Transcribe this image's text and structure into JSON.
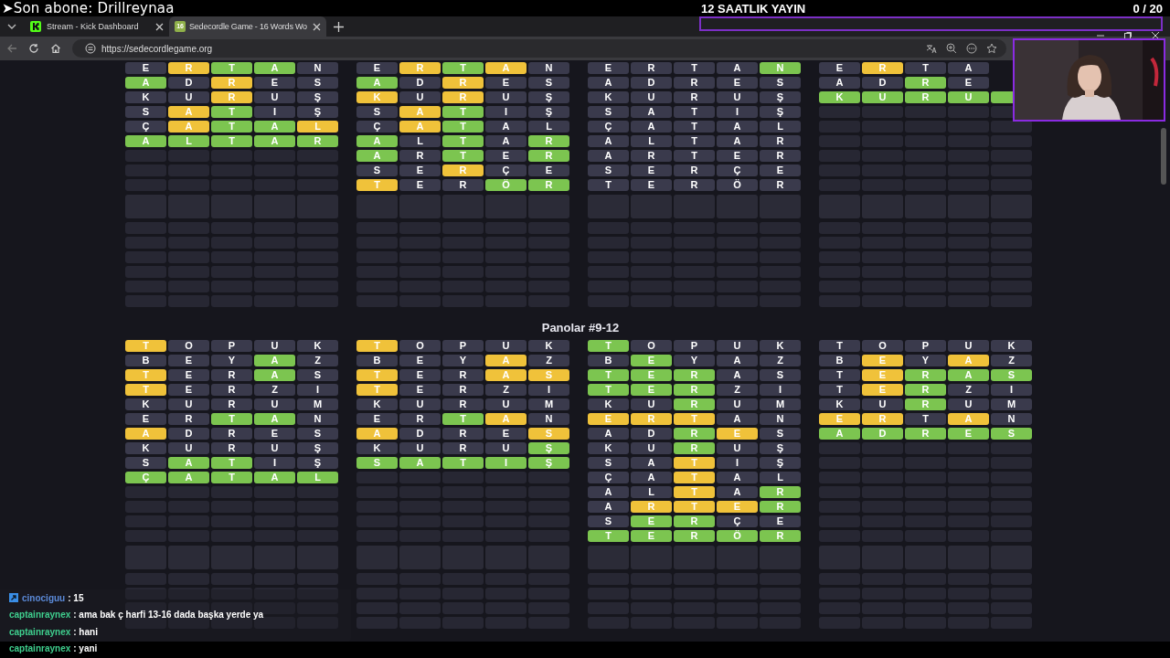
{
  "stream_overlay": {
    "latest_subscriber": "➤Son abone: Drillreynaa",
    "title": "12 SAATLIK YAYIN",
    "goal_count": "0 / 20"
  },
  "browser": {
    "tabs": [
      {
        "label": "Stream - Kick Dashboard",
        "selected": false
      },
      {
        "label": "Sedecordle Game - 16 Words Wo",
        "selected": true,
        "icon_text": "16"
      }
    ],
    "address": "https://sedecordlegame.org"
  },
  "boards_top": [
    {
      "rows": [
        [
          {
            "letter": "E",
            "kind": "absent"
          },
          {
            "letter": "R",
            "kind": "present"
          },
          {
            "letter": "T",
            "kind": "correct"
          },
          {
            "letter": "A",
            "kind": "correct"
          },
          {
            "letter": "N",
            "kind": "absent"
          }
        ],
        [
          {
            "letter": "A",
            "kind": "correct"
          },
          {
            "letter": "D",
            "kind": "absent"
          },
          {
            "letter": "R",
            "kind": "present"
          },
          {
            "letter": "E",
            "kind": "absent"
          },
          {
            "letter": "S",
            "kind": "absent"
          }
        ],
        [
          {
            "letter": "K",
            "kind": "absent"
          },
          {
            "letter": "U",
            "kind": "absent"
          },
          {
            "letter": "R",
            "kind": "present"
          },
          {
            "letter": "U",
            "kind": "absent"
          },
          {
            "letter": "Ş",
            "kind": "absent"
          }
        ],
        [
          {
            "letter": "S",
            "kind": "absent"
          },
          {
            "letter": "A",
            "kind": "present"
          },
          {
            "letter": "T",
            "kind": "correct"
          },
          {
            "letter": "I",
            "kind": "absent"
          },
          {
            "letter": "Ş",
            "kind": "absent"
          }
        ],
        [
          {
            "letter": "Ç",
            "kind": "absent"
          },
          {
            "letter": "A",
            "kind": "present"
          },
          {
            "letter": "T",
            "kind": "correct"
          },
          {
            "letter": "A",
            "kind": "correct"
          },
          {
            "letter": "L",
            "kind": "present"
          }
        ],
        [
          {
            "letter": "A",
            "kind": "correct"
          },
          {
            "letter": "L",
            "kind": "correct"
          },
          {
            "letter": "T",
            "kind": "correct"
          },
          {
            "letter": "A",
            "kind": "correct"
          },
          {
            "letter": "R",
            "kind": "correct"
          }
        ]
      ]
    },
    {
      "rows": [
        [
          {
            "letter": "E",
            "kind": "absent"
          },
          {
            "letter": "R",
            "kind": "present"
          },
          {
            "letter": "T",
            "kind": "correct"
          },
          {
            "letter": "A",
            "kind": "present"
          },
          {
            "letter": "N",
            "kind": "absent"
          }
        ],
        [
          {
            "letter": "A",
            "kind": "correct"
          },
          {
            "letter": "D",
            "kind": "absent"
          },
          {
            "letter": "R",
            "kind": "present"
          },
          {
            "letter": "E",
            "kind": "absent"
          },
          {
            "letter": "S",
            "kind": "absent"
          }
        ],
        [
          {
            "letter": "K",
            "kind": "present"
          },
          {
            "letter": "U",
            "kind": "absent"
          },
          {
            "letter": "R",
            "kind": "present"
          },
          {
            "letter": "U",
            "kind": "absent"
          },
          {
            "letter": "Ş",
            "kind": "absent"
          }
        ],
        [
          {
            "letter": "S",
            "kind": "absent"
          },
          {
            "letter": "A",
            "kind": "present"
          },
          {
            "letter": "T",
            "kind": "correct"
          },
          {
            "letter": "I",
            "kind": "absent"
          },
          {
            "letter": "Ş",
            "kind": "absent"
          }
        ],
        [
          {
            "letter": "Ç",
            "kind": "absent"
          },
          {
            "letter": "A",
            "kind": "present"
          },
          {
            "letter": "T",
            "kind": "correct"
          },
          {
            "letter": "A",
            "kind": "absent"
          },
          {
            "letter": "L",
            "kind": "absent"
          }
        ],
        [
          {
            "letter": "A",
            "kind": "correct"
          },
          {
            "letter": "L",
            "kind": "absent"
          },
          {
            "letter": "T",
            "kind": "correct"
          },
          {
            "letter": "A",
            "kind": "absent"
          },
          {
            "letter": "R",
            "kind": "correct"
          }
        ],
        [
          {
            "letter": "A",
            "kind": "correct"
          },
          {
            "letter": "R",
            "kind": "absent"
          },
          {
            "letter": "T",
            "kind": "correct"
          },
          {
            "letter": "E",
            "kind": "absent"
          },
          {
            "letter": "R",
            "kind": "correct"
          }
        ],
        [
          {
            "letter": "S",
            "kind": "absent"
          },
          {
            "letter": "E",
            "kind": "absent"
          },
          {
            "letter": "R",
            "kind": "present"
          },
          {
            "letter": "Ç",
            "kind": "absent"
          },
          {
            "letter": "E",
            "kind": "absent"
          }
        ],
        [
          {
            "letter": "T",
            "kind": "present"
          },
          {
            "letter": "E",
            "kind": "absent"
          },
          {
            "letter": "R",
            "kind": "absent"
          },
          {
            "letter": "Ö",
            "kind": "correct"
          },
          {
            "letter": "R",
            "kind": "correct"
          }
        ]
      ]
    },
    {
      "rows": [
        [
          {
            "letter": "E",
            "kind": "absent"
          },
          {
            "letter": "R",
            "kind": "absent"
          },
          {
            "letter": "T",
            "kind": "absent"
          },
          {
            "letter": "A",
            "kind": "absent"
          },
          {
            "letter": "N",
            "kind": "correct"
          }
        ],
        [
          {
            "letter": "A",
            "kind": "absent"
          },
          {
            "letter": "D",
            "kind": "absent"
          },
          {
            "letter": "R",
            "kind": "absent"
          },
          {
            "letter": "E",
            "kind": "absent"
          },
          {
            "letter": "S",
            "kind": "absent"
          }
        ],
        [
          {
            "letter": "K",
            "kind": "absent"
          },
          {
            "letter": "U",
            "kind": "absent"
          },
          {
            "letter": "R",
            "kind": "absent"
          },
          {
            "letter": "U",
            "kind": "absent"
          },
          {
            "letter": "Ş",
            "kind": "absent"
          }
        ],
        [
          {
            "letter": "S",
            "kind": "absent"
          },
          {
            "letter": "A",
            "kind": "absent"
          },
          {
            "letter": "T",
            "kind": "absent"
          },
          {
            "letter": "I",
            "kind": "absent"
          },
          {
            "letter": "Ş",
            "kind": "absent"
          }
        ],
        [
          {
            "letter": "Ç",
            "kind": "absent"
          },
          {
            "letter": "A",
            "kind": "absent"
          },
          {
            "letter": "T",
            "kind": "absent"
          },
          {
            "letter": "A",
            "kind": "absent"
          },
          {
            "letter": "L",
            "kind": "absent"
          }
        ],
        [
          {
            "letter": "A",
            "kind": "absent"
          },
          {
            "letter": "L",
            "kind": "absent"
          },
          {
            "letter": "T",
            "kind": "absent"
          },
          {
            "letter": "A",
            "kind": "absent"
          },
          {
            "letter": "R",
            "kind": "absent"
          }
        ],
        [
          {
            "letter": "A",
            "kind": "absent"
          },
          {
            "letter": "R",
            "kind": "absent"
          },
          {
            "letter": "T",
            "kind": "absent"
          },
          {
            "letter": "E",
            "kind": "absent"
          },
          {
            "letter": "R",
            "kind": "absent"
          }
        ],
        [
          {
            "letter": "S",
            "kind": "absent"
          },
          {
            "letter": "E",
            "kind": "absent"
          },
          {
            "letter": "R",
            "kind": "absent"
          },
          {
            "letter": "Ç",
            "kind": "absent"
          },
          {
            "letter": "E",
            "kind": "absent"
          }
        ],
        [
          {
            "letter": "T",
            "kind": "absent"
          },
          {
            "letter": "E",
            "kind": "absent"
          },
          {
            "letter": "R",
            "kind": "absent"
          },
          {
            "letter": "Ö",
            "kind": "absent"
          },
          {
            "letter": "R",
            "kind": "absent"
          }
        ]
      ]
    },
    {
      "rows": [
        [
          {
            "letter": "E",
            "kind": "absent"
          },
          {
            "letter": "R",
            "kind": "present"
          },
          {
            "letter": "T",
            "kind": "absent"
          },
          {
            "letter": "A",
            "kind": "absent"
          }
        ],
        [
          {
            "letter": "A",
            "kind": "absent"
          },
          {
            "letter": "D",
            "kind": "absent"
          },
          {
            "letter": "R",
            "kind": "correct"
          },
          {
            "letter": "E",
            "kind": "absent"
          }
        ],
        [
          {
            "letter": "K",
            "kind": "correct"
          },
          {
            "letter": "U",
            "kind": "correct"
          },
          {
            "letter": "R",
            "kind": "correct"
          },
          {
            "letter": "U",
            "kind": "correct"
          },
          {
            "kind": "correct"
          }
        ]
      ]
    }
  ],
  "section_heading": "Panolar #9-12",
  "boards_bottom": [
    {
      "rows": [
        [
          {
            "letter": "T",
            "kind": "present"
          },
          {
            "letter": "O",
            "kind": "absent"
          },
          {
            "letter": "P",
            "kind": "absent"
          },
          {
            "letter": "U",
            "kind": "absent"
          },
          {
            "letter": "K",
            "kind": "absent"
          }
        ],
        [
          {
            "letter": "B",
            "kind": "absent"
          },
          {
            "letter": "E",
            "kind": "absent"
          },
          {
            "letter": "Y",
            "kind": "absent"
          },
          {
            "letter": "A",
            "kind": "correct"
          },
          {
            "letter": "Z",
            "kind": "absent"
          }
        ],
        [
          {
            "letter": "T",
            "kind": "present"
          },
          {
            "letter": "E",
            "kind": "absent"
          },
          {
            "letter": "R",
            "kind": "absent"
          },
          {
            "letter": "A",
            "kind": "correct"
          },
          {
            "letter": "S",
            "kind": "absent"
          }
        ],
        [
          {
            "letter": "T",
            "kind": "present"
          },
          {
            "letter": "E",
            "kind": "absent"
          },
          {
            "letter": "R",
            "kind": "absent"
          },
          {
            "letter": "Z",
            "kind": "absent"
          },
          {
            "letter": "I",
            "kind": "absent"
          }
        ],
        [
          {
            "letter": "K",
            "kind": "absent"
          },
          {
            "letter": "U",
            "kind": "absent"
          },
          {
            "letter": "R",
            "kind": "absent"
          },
          {
            "letter": "U",
            "kind": "absent"
          },
          {
            "letter": "M",
            "kind": "absent"
          }
        ],
        [
          {
            "letter": "E",
            "kind": "absent"
          },
          {
            "letter": "R",
            "kind": "absent"
          },
          {
            "letter": "T",
            "kind": "correct"
          },
          {
            "letter": "A",
            "kind": "correct"
          },
          {
            "letter": "N",
            "kind": "absent"
          }
        ],
        [
          {
            "letter": "A",
            "kind": "present"
          },
          {
            "letter": "D",
            "kind": "absent"
          },
          {
            "letter": "R",
            "kind": "absent"
          },
          {
            "letter": "E",
            "kind": "absent"
          },
          {
            "letter": "S",
            "kind": "absent"
          }
        ],
        [
          {
            "letter": "K",
            "kind": "absent"
          },
          {
            "letter": "U",
            "kind": "absent"
          },
          {
            "letter": "R",
            "kind": "absent"
          },
          {
            "letter": "U",
            "kind": "absent"
          },
          {
            "letter": "Ş",
            "kind": "absent"
          }
        ],
        [
          {
            "letter": "S",
            "kind": "absent"
          },
          {
            "letter": "A",
            "kind": "correct"
          },
          {
            "letter": "T",
            "kind": "correct"
          },
          {
            "letter": "I",
            "kind": "absent"
          },
          {
            "letter": "Ş",
            "kind": "absent"
          }
        ],
        [
          {
            "letter": "Ç",
            "kind": "correct"
          },
          {
            "letter": "A",
            "kind": "correct"
          },
          {
            "letter": "T",
            "kind": "correct"
          },
          {
            "letter": "A",
            "kind": "correct"
          },
          {
            "letter": "L",
            "kind": "correct"
          }
        ]
      ]
    },
    {
      "rows": [
        [
          {
            "letter": "T",
            "kind": "present"
          },
          {
            "letter": "O",
            "kind": "absent"
          },
          {
            "letter": "P",
            "kind": "absent"
          },
          {
            "letter": "U",
            "kind": "absent"
          },
          {
            "letter": "K",
            "kind": "absent"
          }
        ],
        [
          {
            "letter": "B",
            "kind": "absent"
          },
          {
            "letter": "E",
            "kind": "absent"
          },
          {
            "letter": "Y",
            "kind": "absent"
          },
          {
            "letter": "A",
            "kind": "present"
          },
          {
            "letter": "Z",
            "kind": "absent"
          }
        ],
        [
          {
            "letter": "T",
            "kind": "present"
          },
          {
            "letter": "E",
            "kind": "absent"
          },
          {
            "letter": "R",
            "kind": "absent"
          },
          {
            "letter": "A",
            "kind": "present"
          },
          {
            "letter": "S",
            "kind": "present"
          }
        ],
        [
          {
            "letter": "T",
            "kind": "present"
          },
          {
            "letter": "E",
            "kind": "absent"
          },
          {
            "letter": "R",
            "kind": "absent"
          },
          {
            "letter": "Z",
            "kind": "absent"
          },
          {
            "letter": "I",
            "kind": "absent"
          }
        ],
        [
          {
            "letter": "K",
            "kind": "absent"
          },
          {
            "letter": "U",
            "kind": "absent"
          },
          {
            "letter": "R",
            "kind": "absent"
          },
          {
            "letter": "U",
            "kind": "absent"
          },
          {
            "letter": "M",
            "kind": "absent"
          }
        ],
        [
          {
            "letter": "E",
            "kind": "absent"
          },
          {
            "letter": "R",
            "kind": "absent"
          },
          {
            "letter": "T",
            "kind": "correct"
          },
          {
            "letter": "A",
            "kind": "present"
          },
          {
            "letter": "N",
            "kind": "absent"
          }
        ],
        [
          {
            "letter": "A",
            "kind": "present"
          },
          {
            "letter": "D",
            "kind": "absent"
          },
          {
            "letter": "R",
            "kind": "absent"
          },
          {
            "letter": "E",
            "kind": "absent"
          },
          {
            "letter": "S",
            "kind": "present"
          }
        ],
        [
          {
            "letter": "K",
            "kind": "absent"
          },
          {
            "letter": "U",
            "kind": "absent"
          },
          {
            "letter": "R",
            "kind": "absent"
          },
          {
            "letter": "U",
            "kind": "absent"
          },
          {
            "letter": "Ş",
            "kind": "correct"
          }
        ],
        [
          {
            "letter": "S",
            "kind": "correct"
          },
          {
            "letter": "A",
            "kind": "correct"
          },
          {
            "letter": "T",
            "kind": "correct"
          },
          {
            "letter": "I",
            "kind": "correct"
          },
          {
            "letter": "Ş",
            "kind": "correct"
          }
        ]
      ]
    },
    {
      "rows": [
        [
          {
            "letter": "T",
            "kind": "correct"
          },
          {
            "letter": "O",
            "kind": "absent"
          },
          {
            "letter": "P",
            "kind": "absent"
          },
          {
            "letter": "U",
            "kind": "absent"
          },
          {
            "letter": "K",
            "kind": "absent"
          }
        ],
        [
          {
            "letter": "B",
            "kind": "absent"
          },
          {
            "letter": "E",
            "kind": "correct"
          },
          {
            "letter": "Y",
            "kind": "absent"
          },
          {
            "letter": "A",
            "kind": "absent"
          },
          {
            "letter": "Z",
            "kind": "absent"
          }
        ],
        [
          {
            "letter": "T",
            "kind": "correct"
          },
          {
            "letter": "E",
            "kind": "correct"
          },
          {
            "letter": "R",
            "kind": "correct"
          },
          {
            "letter": "A",
            "kind": "absent"
          },
          {
            "letter": "S",
            "kind": "absent"
          }
        ],
        [
          {
            "letter": "T",
            "kind": "correct"
          },
          {
            "letter": "E",
            "kind": "correct"
          },
          {
            "letter": "R",
            "kind": "correct"
          },
          {
            "letter": "Z",
            "kind": "absent"
          },
          {
            "letter": "I",
            "kind": "absent"
          }
        ],
        [
          {
            "letter": "K",
            "kind": "absent"
          },
          {
            "letter": "U",
            "kind": "absent"
          },
          {
            "letter": "R",
            "kind": "correct"
          },
          {
            "letter": "U",
            "kind": "absent"
          },
          {
            "letter": "M",
            "kind": "absent"
          }
        ],
        [
          {
            "letter": "E",
            "kind": "present"
          },
          {
            "letter": "R",
            "kind": "present"
          },
          {
            "letter": "T",
            "kind": "present"
          },
          {
            "letter": "A",
            "kind": "absent"
          },
          {
            "letter": "N",
            "kind": "absent"
          }
        ],
        [
          {
            "letter": "A",
            "kind": "absent"
          },
          {
            "letter": "D",
            "kind": "absent"
          },
          {
            "letter": "R",
            "kind": "correct"
          },
          {
            "letter": "E",
            "kind": "present"
          },
          {
            "letter": "S",
            "kind": "absent"
          }
        ],
        [
          {
            "letter": "K",
            "kind": "absent"
          },
          {
            "letter": "U",
            "kind": "absent"
          },
          {
            "letter": "R",
            "kind": "correct"
          },
          {
            "letter": "U",
            "kind": "absent"
          },
          {
            "letter": "Ş",
            "kind": "absent"
          }
        ],
        [
          {
            "letter": "S",
            "kind": "absent"
          },
          {
            "letter": "A",
            "kind": "absent"
          },
          {
            "letter": "T",
            "kind": "present"
          },
          {
            "letter": "I",
            "kind": "absent"
          },
          {
            "letter": "Ş",
            "kind": "absent"
          }
        ],
        [
          {
            "letter": "Ç",
            "kind": "absent"
          },
          {
            "letter": "A",
            "kind": "absent"
          },
          {
            "letter": "T",
            "kind": "present"
          },
          {
            "letter": "A",
            "kind": "absent"
          },
          {
            "letter": "L",
            "kind": "absent"
          }
        ],
        [
          {
            "letter": "A",
            "kind": "absent"
          },
          {
            "letter": "L",
            "kind": "absent"
          },
          {
            "letter": "T",
            "kind": "present"
          },
          {
            "letter": "A",
            "kind": "absent"
          },
          {
            "letter": "R",
            "kind": "correct"
          }
        ],
        [
          {
            "letter": "A",
            "kind": "absent"
          },
          {
            "letter": "R",
            "kind": "present"
          },
          {
            "letter": "T",
            "kind": "present"
          },
          {
            "letter": "E",
            "kind": "present"
          },
          {
            "letter": "R",
            "kind": "correct"
          }
        ],
        [
          {
            "letter": "S",
            "kind": "absent"
          },
          {
            "letter": "E",
            "kind": "correct"
          },
          {
            "letter": "R",
            "kind": "correct"
          },
          {
            "letter": "Ç",
            "kind": "absent"
          },
          {
            "letter": "E",
            "kind": "absent"
          }
        ],
        [
          {
            "letter": "T",
            "kind": "correct"
          },
          {
            "letter": "E",
            "kind": "correct"
          },
          {
            "letter": "R",
            "kind": "correct"
          },
          {
            "letter": "Ö",
            "kind": "correct"
          },
          {
            "letter": "R",
            "kind": "correct"
          }
        ]
      ]
    },
    {
      "rows": [
        [
          {
            "letter": "T",
            "kind": "absent"
          },
          {
            "letter": "O",
            "kind": "absent"
          },
          {
            "letter": "P",
            "kind": "absent"
          },
          {
            "letter": "U",
            "kind": "absent"
          },
          {
            "letter": "K",
            "kind": "absent"
          }
        ],
        [
          {
            "letter": "B",
            "kind": "absent"
          },
          {
            "letter": "E",
            "kind": "present"
          },
          {
            "letter": "Y",
            "kind": "absent"
          },
          {
            "letter": "A",
            "kind": "present"
          },
          {
            "letter": "Z",
            "kind": "absent"
          }
        ],
        [
          {
            "letter": "T",
            "kind": "absent"
          },
          {
            "letter": "E",
            "kind": "present"
          },
          {
            "letter": "R",
            "kind": "correct"
          },
          {
            "letter": "A",
            "kind": "correct"
          },
          {
            "letter": "S",
            "kind": "correct"
          }
        ],
        [
          {
            "letter": "T",
            "kind": "absent"
          },
          {
            "letter": "E",
            "kind": "present"
          },
          {
            "letter": "R",
            "kind": "correct"
          },
          {
            "letter": "Z",
            "kind": "absent"
          },
          {
            "letter": "I",
            "kind": "absent"
          }
        ],
        [
          {
            "letter": "K",
            "kind": "absent"
          },
          {
            "letter": "U",
            "kind": "absent"
          },
          {
            "letter": "R",
            "kind": "correct"
          },
          {
            "letter": "U",
            "kind": "absent"
          },
          {
            "letter": "M",
            "kind": "absent"
          }
        ],
        [
          {
            "letter": "E",
            "kind": "present"
          },
          {
            "letter": "R",
            "kind": "present"
          },
          {
            "letter": "T",
            "kind": "absent"
          },
          {
            "letter": "A",
            "kind": "present"
          },
          {
            "letter": "N",
            "kind": "absent"
          }
        ],
        [
          {
            "letter": "A",
            "kind": "correct"
          },
          {
            "letter": "D",
            "kind": "correct"
          },
          {
            "letter": "R",
            "kind": "correct"
          },
          {
            "letter": "E",
            "kind": "correct"
          },
          {
            "letter": "S",
            "kind": "correct"
          }
        ]
      ]
    }
  ],
  "chat": [
    {
      "user": "cinociguu",
      "message": ": 15",
      "badge": true,
      "color": "#5b8ad8"
    },
    {
      "user": "captainraynex",
      "message": ": ama bak ç harfi 13-16 dada başka yerde ya",
      "badge": false,
      "color": "#3fcf8e"
    },
    {
      "user": "captainraynex",
      "message": ": hani",
      "badge": false,
      "color": "#3fcf8e"
    },
    {
      "user": "captainraynex",
      "message": ": yani",
      "badge": false,
      "color": "#3fcf8e"
    }
  ]
}
